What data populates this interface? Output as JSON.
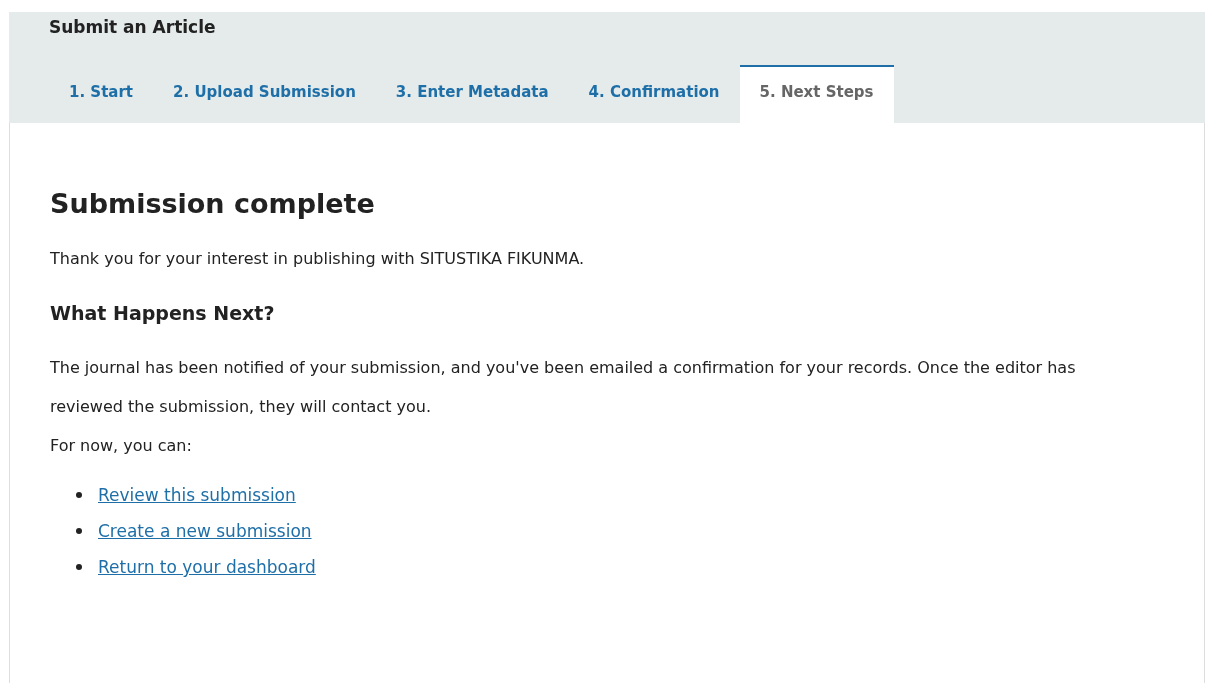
{
  "header": {
    "title": "Submit an Article"
  },
  "tabs": [
    {
      "label": "1. Start",
      "selected": false
    },
    {
      "label": "2. Upload Submission",
      "selected": false
    },
    {
      "label": "3. Enter Metadata",
      "selected": false
    },
    {
      "label": "4. Confirmation",
      "selected": false
    },
    {
      "label": "5. Next Steps",
      "selected": true
    }
  ],
  "content": {
    "heading": "Submission complete",
    "thanks": "Thank you for your interest in publishing with SITUSTIKA FIKUNMA.",
    "subheading": "What Happens Next?",
    "paragraph": "The journal has been notified of your submission, and you've been emailed a confirmation for your records. Once the editor has reviewed the submission, they will contact you.",
    "lead": "For now, you can:",
    "links": [
      "Review this submission",
      "Create a new submission",
      "Return to your dashboard"
    ]
  }
}
